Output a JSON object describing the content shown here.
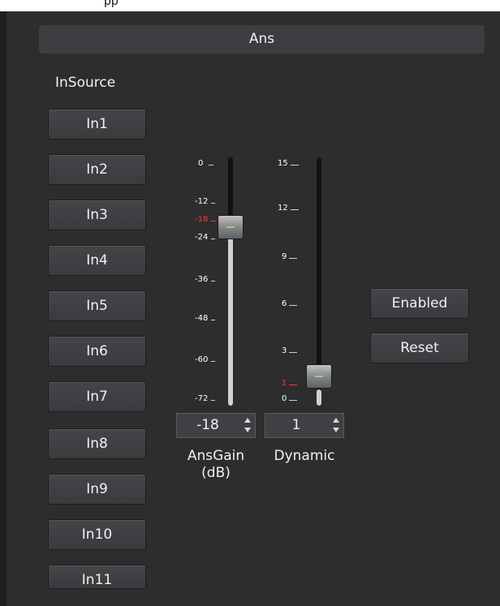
{
  "window": {
    "partial_title": "pp"
  },
  "header": {
    "title": "Ans"
  },
  "insource": {
    "label": "InSource",
    "buttons": [
      "In1",
      "In2",
      "In3",
      "In4",
      "In5",
      "In6",
      "In7",
      "In8",
      "In9",
      "In10",
      "In11"
    ]
  },
  "ans_gain": {
    "ticks": [
      "0",
      "-12",
      "-18",
      "-24",
      "-36",
      "-48",
      "-60",
      "-72"
    ],
    "current_tick": "-18",
    "value": "-18",
    "min": -72,
    "max": 0,
    "label_line1": "AnsGain",
    "label_line2": "(dB)"
  },
  "dynamic": {
    "ticks": [
      "15",
      "12",
      "9",
      "6",
      "3",
      "1",
      "0"
    ],
    "current_tick": "1",
    "value": "1",
    "min": 0,
    "max": 15,
    "label": "Dynamic"
  },
  "actions": {
    "enabled_label": "Enabled",
    "reset_label": "Reset"
  },
  "colors": {
    "background": "#2d2d2d",
    "button": "#3f4043",
    "highlight_tick": "#ff3333",
    "handle_indicator": "#9cd07c"
  }
}
